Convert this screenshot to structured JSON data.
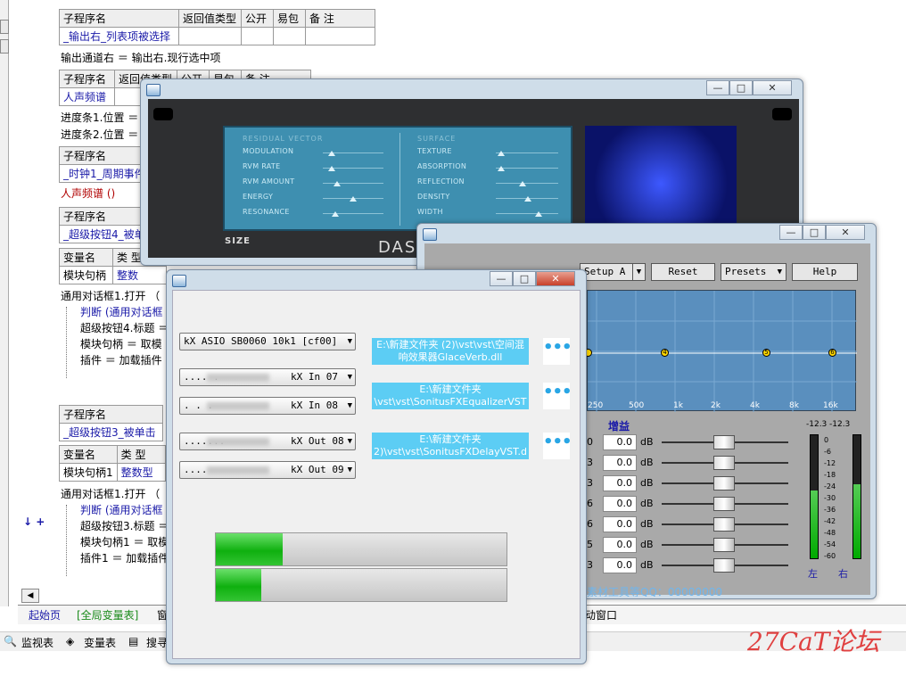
{
  "ide": {
    "hdr": [
      "子程序名",
      "返回值类型",
      "公开",
      "易包",
      "备 注"
    ],
    "sub1": "_输出右_列表项被选择",
    "line1": "输出通道右 ＝ 输出右.现行选中项",
    "sub2": "人声频谱",
    "line2a": "进度条1.位置 ＝",
    "line2b": "进度条2.位置 ＝",
    "sub3": "_时钟1_周期事件",
    "line3": "人声频谱 ()",
    "sub4": "_超级按钮4_被单",
    "var_hdr": [
      "变量名",
      "类 型"
    ],
    "var1": [
      "模块句柄",
      "整数"
    ],
    "code4": [
      "通用对话框1.打开 （",
      "判断 (通用对话框",
      "超级按钮4.标题 ＝",
      "模块句柄 ＝ 取模",
      "插件 ＝ 加载插件"
    ],
    "sub5": "_超级按钮3_被单击",
    "var2": [
      "模块句柄1",
      "整数型"
    ],
    "code5": [
      "通用对话框1.打开 （",
      "判断 (通用对话框",
      "超级按钮3.标题 ＝",
      "模块句柄1 ＝ 取模",
      "插件1 ＝ 加载插件"
    ],
    "gutter_marks": "↓ +",
    "bottom_tabs": [
      "起始页",
      "[全局变量表]",
      "窗",
      "动窗口"
    ],
    "toolbar": [
      "监视表",
      "变量表",
      "搜寻"
    ]
  },
  "watermark": "27CaT论坛",
  "reverb": {
    "head_left": "RESIDUAL VECTOR",
    "head_right": "SURFACE",
    "left_params": [
      "MODULATION",
      "RVM RATE",
      "RVM AMOUNT",
      "ENERGY",
      "RESONANCE"
    ],
    "right_params": [
      "TEXTURE",
      "ABSORPTION",
      "REFLECTION",
      "DENSITY",
      "WIDTH"
    ],
    "size_label": "SIZE",
    "brand": "DAS"
  },
  "eq": {
    "buttons": [
      "Setup A",
      "Reset",
      "Presets",
      "Help"
    ],
    "freqs": [
      "250",
      "500",
      "1k",
      "2k",
      "4k",
      "8k",
      "16k"
    ],
    "dots": [
      "4",
      "5",
      "6"
    ],
    "gain_label": "增益",
    "gain_values": [
      "0.0",
      "0.0",
      "0.0",
      "0.0",
      "0.0",
      "0.0",
      "0.0"
    ],
    "band_digits": [
      "0",
      "3",
      "3",
      "6",
      "6",
      "5",
      "3"
    ],
    "unit": "dB",
    "meter_top": [
      "-12.3",
      "-12.3"
    ],
    "meter_scale": [
      "0",
      "-6",
      "-12",
      "-18",
      "-24",
      "-30",
      "-36",
      "-42",
      "-48",
      "-54",
      "-60"
    ],
    "meter_levels": [
      0.55,
      0.6
    ],
    "left_label": "左",
    "right_label": "右",
    "footer": "素材工具等QQ：00000000"
  },
  "host": {
    "input_device": "kX ASIO SB0060 10k1 [cf00]",
    "combos": [
      "kX In 07",
      "kX In 08",
      "kX Out 08",
      "kX Out 09"
    ],
    "combo_prefix": [
      ".... .",
      ". . .",
      ".......",
      "...."
    ],
    "paths": [
      "E:\\新建文件夹 (2)\\vst\\vst\\空间混响效果器GlaceVerb.dll",
      "E:\\新建文件夹\\vst\\vst\\SonitusFXEqualizerVST",
      "E:\\新建文件夹2)\\vst\\vst\\SonitusFXDelayVST.d"
    ],
    "dots_label": "•••",
    "progress": [
      0.23,
      0.155
    ]
  },
  "win_btns": {
    "min": "—",
    "max": "□",
    "close": "✕"
  }
}
